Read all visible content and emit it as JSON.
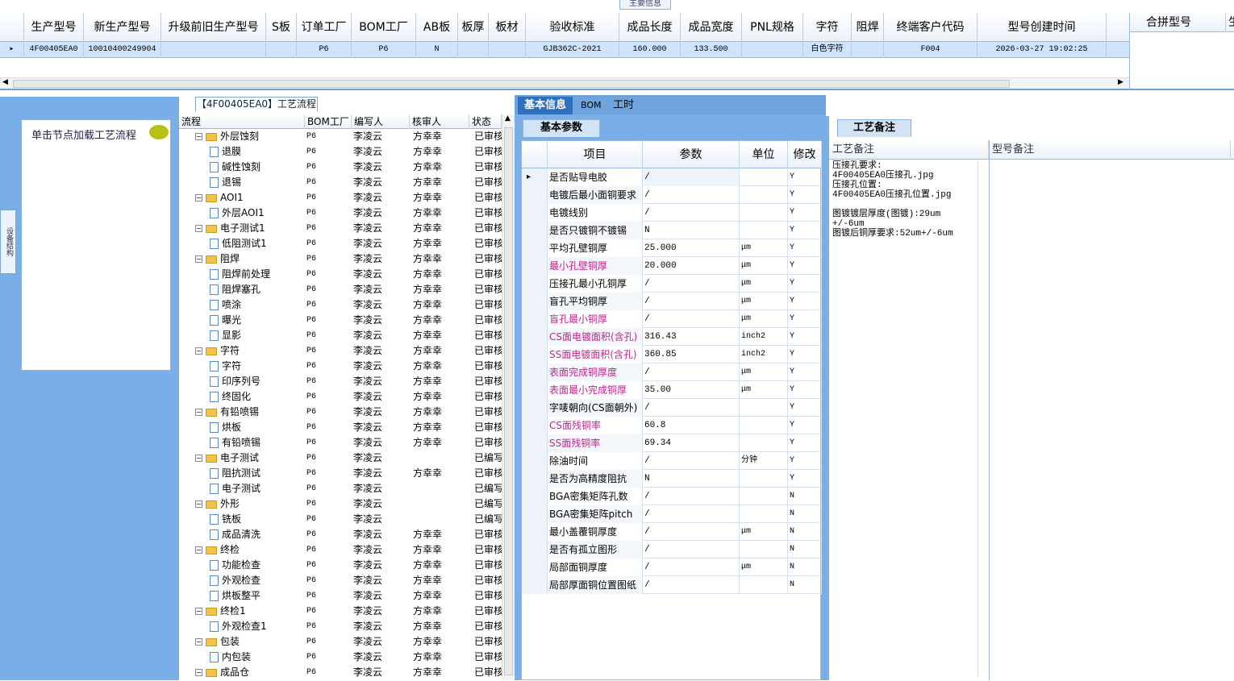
{
  "top_panel": {
    "title": "主要信息",
    "columns": [
      "生产型号",
      "新生产型号",
      "升级前旧生产型号",
      "S板",
      "订单工厂",
      "BOM工厂",
      "AB板",
      "板厚",
      "板材",
      "验收标准",
      "成品长度",
      "成品宽度",
      "PNL规格",
      "字符",
      "阻焊",
      "终端客户代码",
      "型号创建时间"
    ],
    "row": [
      "4F00405EA0",
      "10010400249904",
      "",
      "",
      "P6",
      "P6",
      "N",
      "",
      "",
      "GJB362C-2021",
      "160.000",
      "133.500",
      "",
      "白色字符",
      "",
      "F004",
      "2026-03-27 19:02:25"
    ],
    "merge_header": "合拼型号",
    "merge_header2": "生"
  },
  "left_panel": {
    "tab_label": "设备结构",
    "hint": "单击节点加载工艺流程"
  },
  "tree_panel": {
    "title": "【4F00405EA0】工艺流程",
    "headers": [
      "流程",
      "BOM工厂",
      "编写人",
      "核审人",
      "状态"
    ],
    "rows": [
      {
        "label": "外层蚀刻",
        "level": 0,
        "bom": "P6",
        "writer": "李凌云",
        "reviewer": "方幸幸",
        "status": "已审核"
      },
      {
        "label": "退膜",
        "level": 1,
        "bom": "P6",
        "writer": "李凌云",
        "reviewer": "方幸幸",
        "status": "已审核"
      },
      {
        "label": "碱性蚀刻",
        "level": 1,
        "bom": "P6",
        "writer": "李凌云",
        "reviewer": "方幸幸",
        "status": "已审核"
      },
      {
        "label": "退锡",
        "level": 1,
        "bom": "P6",
        "writer": "李凌云",
        "reviewer": "方幸幸",
        "status": "已审核"
      },
      {
        "label": "AOI1",
        "level": 0,
        "bom": "P6",
        "writer": "李凌云",
        "reviewer": "方幸幸",
        "status": "已审核"
      },
      {
        "label": "外层AOI1",
        "level": 1,
        "bom": "P6",
        "writer": "李凌云",
        "reviewer": "方幸幸",
        "status": "已审核"
      },
      {
        "label": "电子测试1",
        "level": 0,
        "bom": "P6",
        "writer": "李凌云",
        "reviewer": "方幸幸",
        "status": "已审核"
      },
      {
        "label": "低阻测试1",
        "level": 1,
        "bom": "P6",
        "writer": "李凌云",
        "reviewer": "方幸幸",
        "status": "已审核"
      },
      {
        "label": "阻焊",
        "level": 0,
        "bom": "P6",
        "writer": "李凌云",
        "reviewer": "方幸幸",
        "status": "已审核"
      },
      {
        "label": "阻焊前处理",
        "level": 1,
        "bom": "P6",
        "writer": "李凌云",
        "reviewer": "方幸幸",
        "status": "已审核"
      },
      {
        "label": "阻焊塞孔",
        "level": 1,
        "bom": "P6",
        "writer": "李凌云",
        "reviewer": "方幸幸",
        "status": "已审核"
      },
      {
        "label": "喷涂",
        "level": 1,
        "bom": "P6",
        "writer": "李凌云",
        "reviewer": "方幸幸",
        "status": "已审核"
      },
      {
        "label": "曝光",
        "level": 1,
        "bom": "P6",
        "writer": "李凌云",
        "reviewer": "方幸幸",
        "status": "已审核"
      },
      {
        "label": "显影",
        "level": 1,
        "bom": "P6",
        "writer": "李凌云",
        "reviewer": "方幸幸",
        "status": "已审核"
      },
      {
        "label": "字符",
        "level": 0,
        "bom": "P6",
        "writer": "李凌云",
        "reviewer": "方幸幸",
        "status": "已审核"
      },
      {
        "label": "字符",
        "level": 1,
        "bom": "P6",
        "writer": "李凌云",
        "reviewer": "方幸幸",
        "status": "已审核"
      },
      {
        "label": "印序列号",
        "level": 1,
        "bom": "P6",
        "writer": "李凌云",
        "reviewer": "方幸幸",
        "status": "已审核"
      },
      {
        "label": "终固化",
        "level": 1,
        "bom": "P6",
        "writer": "李凌云",
        "reviewer": "方幸幸",
        "status": "已审核"
      },
      {
        "label": "有铅喷锡",
        "level": 0,
        "bom": "P6",
        "writer": "李凌云",
        "reviewer": "方幸幸",
        "status": "已审核"
      },
      {
        "label": "烘板",
        "level": 1,
        "bom": "P6",
        "writer": "李凌云",
        "reviewer": "方幸幸",
        "status": "已审核"
      },
      {
        "label": "有铅喷锡",
        "level": 1,
        "bom": "P6",
        "writer": "李凌云",
        "reviewer": "方幸幸",
        "status": "已审核"
      },
      {
        "label": "电子测试",
        "level": 0,
        "bom": "P6",
        "writer": "李凌云",
        "reviewer": "",
        "status": "已编写"
      },
      {
        "label": "阻抗测试",
        "level": 1,
        "bom": "P6",
        "writer": "李凌云",
        "reviewer": "方幸幸",
        "status": "已审核"
      },
      {
        "label": "电子测试",
        "level": 1,
        "bom": "P6",
        "writer": "李凌云",
        "reviewer": "",
        "status": "已编写"
      },
      {
        "label": "外形",
        "level": 0,
        "bom": "P6",
        "writer": "李凌云",
        "reviewer": "",
        "status": "已编写"
      },
      {
        "label": "铣板",
        "level": 1,
        "bom": "P6",
        "writer": "李凌云",
        "reviewer": "",
        "status": "已编写"
      },
      {
        "label": "成品清洗",
        "level": 1,
        "bom": "P6",
        "writer": "李凌云",
        "reviewer": "方幸幸",
        "status": "已审核"
      },
      {
        "label": "终检",
        "level": 0,
        "bom": "P6",
        "writer": "李凌云",
        "reviewer": "方幸幸",
        "status": "已审核"
      },
      {
        "label": "功能检查",
        "level": 1,
        "bom": "P6",
        "writer": "李凌云",
        "reviewer": "方幸幸",
        "status": "已审核"
      },
      {
        "label": "外观检查",
        "level": 1,
        "bom": "P6",
        "writer": "李凌云",
        "reviewer": "方幸幸",
        "status": "已审核"
      },
      {
        "label": "烘板整平",
        "level": 1,
        "bom": "P6",
        "writer": "李凌云",
        "reviewer": "方幸幸",
        "status": "已审核"
      },
      {
        "label": "终检1",
        "level": 0,
        "bom": "P6",
        "writer": "李凌云",
        "reviewer": "方幸幸",
        "status": "已审核"
      },
      {
        "label": "外观检查1",
        "level": 1,
        "bom": "P6",
        "writer": "李凌云",
        "reviewer": "方幸幸",
        "status": "已审核"
      },
      {
        "label": "包装",
        "level": 0,
        "bom": "P6",
        "writer": "李凌云",
        "reviewer": "方幸幸",
        "status": "已审核"
      },
      {
        "label": "内包装",
        "level": 1,
        "bom": "P6",
        "writer": "李凌云",
        "reviewer": "方幸幸",
        "status": "已审核"
      },
      {
        "label": "成品仓",
        "level": 0,
        "bom": "P6",
        "writer": "李凌云",
        "reviewer": "方幸幸",
        "status": "已审核"
      }
    ]
  },
  "mid_panel": {
    "tabs": [
      "基本信息",
      "BOM",
      "工时"
    ],
    "sub_tab": "基本参数",
    "headers": [
      "项目",
      "参数",
      "单位",
      "修改"
    ],
    "rows": [
      {
        "item": "是否贴导电胶",
        "param": "/",
        "unit": "",
        "mod": "Y",
        "pink": false
      },
      {
        "item": "电镀后最小面铜要求",
        "param": "/",
        "unit": "",
        "mod": "Y",
        "pink": false
      },
      {
        "item": "电镀线别",
        "param": "/",
        "unit": "",
        "mod": "Y",
        "pink": false
      },
      {
        "item": "是否只镀铜不镀锡",
        "param": "N",
        "unit": "",
        "mod": "Y",
        "pink": false
      },
      {
        "item": "平均孔壁铜厚",
        "param": "25.000",
        "unit": "μm",
        "mod": "Y",
        "pink": false
      },
      {
        "item": "最小孔壁铜厚",
        "param": "20.000",
        "unit": "μm",
        "mod": "Y",
        "pink": true
      },
      {
        "item": "压接孔最小孔铜厚",
        "param": "/",
        "unit": "μm",
        "mod": "Y",
        "pink": false
      },
      {
        "item": "盲孔平均铜厚",
        "param": "/",
        "unit": "μm",
        "mod": "Y",
        "pink": false
      },
      {
        "item": "盲孔最小铜厚",
        "param": "/",
        "unit": "μm",
        "mod": "Y",
        "pink": true
      },
      {
        "item": "CS面电镀面积(含孔)",
        "param": "316.43",
        "unit": "inch2",
        "mod": "Y",
        "pink": true
      },
      {
        "item": "SS面电镀面积(含孔)",
        "param": "360.85",
        "unit": "inch2",
        "mod": "Y",
        "pink": true
      },
      {
        "item": "表面完成铜厚度",
        "param": "/",
        "unit": "μm",
        "mod": "Y",
        "pink": true
      },
      {
        "item": "表面最小完成铜厚",
        "param": "35.00",
        "unit": "μm",
        "mod": "Y",
        "pink": true
      },
      {
        "item": "字唛朝向(CS面朝外)",
        "param": "/",
        "unit": "",
        "mod": "Y",
        "pink": false
      },
      {
        "item": "CS面残铜率",
        "param": "60.8",
        "unit": "",
        "mod": "Y",
        "pink": true
      },
      {
        "item": "SS面残铜率",
        "param": "69.34",
        "unit": "",
        "mod": "Y",
        "pink": true
      },
      {
        "item": "除油时间",
        "param": "/",
        "unit": "分钟",
        "mod": "Y",
        "pink": false
      },
      {
        "item": "是否为高精度阻抗",
        "param": "N",
        "unit": "",
        "mod": "Y",
        "pink": false
      },
      {
        "item": "BGA密集矩阵孔数",
        "param": "/",
        "unit": "",
        "mod": "N",
        "pink": false
      },
      {
        "item": "BGA密集矩阵pitch",
        "param": "/",
        "unit": "",
        "mod": "N",
        "pink": false
      },
      {
        "item": "最小盖覆铜厚度",
        "param": "/",
        "unit": "μm",
        "mod": "N",
        "pink": false
      },
      {
        "item": "是否有孤立图形",
        "param": "/",
        "unit": "",
        "mod": "N",
        "pink": false
      },
      {
        "item": "局部面铜厚度",
        "param": "/",
        "unit": "μm",
        "mod": "N",
        "pink": false
      },
      {
        "item": "局部厚面铜位置图纸",
        "param": "/",
        "unit": "",
        "mod": "N",
        "pink": false
      }
    ]
  },
  "right_panel": {
    "tab": "工艺备注",
    "headers": [
      "工艺备注",
      "型号备注"
    ],
    "note": "压接孔要求:\n4F00405EA0压接孔.jpg\n压接孔位置:\n4F00405EA0压接孔位置.jpg\n\n图镀镀层厚度(图镀):29um\n+/-6um\n图镀后铜厚要求:52um+/-6um"
  },
  "colors": {
    "accent": "#2f6fc0",
    "panel_bg": "#7aaee6",
    "selected_row": "#cfe3fb",
    "pink_text": "#c0238a",
    "folder": "#f1c34a"
  }
}
